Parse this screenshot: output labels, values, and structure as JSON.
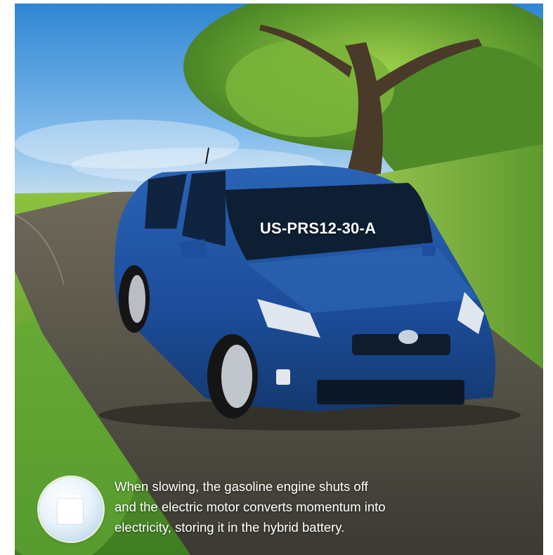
{
  "image": {
    "description_icon": "battery-icon",
    "plate_text": "US-PRS12-30-A",
    "caption_lines": [
      "When slowing, the gasoline engine shuts off",
      "and the electric motor converts momentum into",
      "electricity, storing it in the hybrid battery."
    ]
  },
  "colors": {
    "car_body": "#1f4f9c",
    "sky": "#5aa8e6",
    "grass": "#6aa83a",
    "road": "#4a4a42"
  }
}
